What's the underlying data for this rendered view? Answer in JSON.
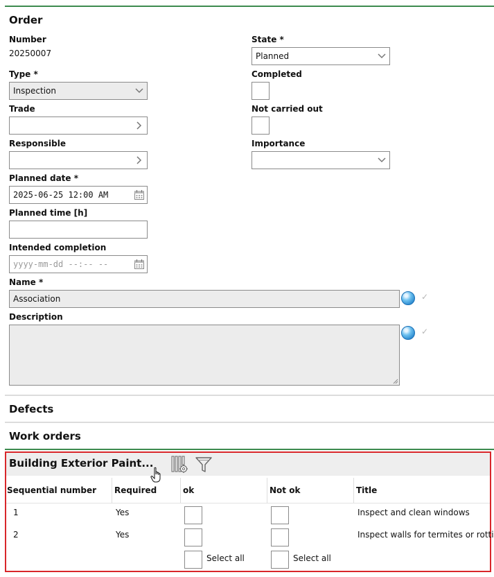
{
  "order": {
    "title": "Order",
    "number_label": "Number",
    "number_value": "20250007",
    "state_label": "State *",
    "state_value": "Planned",
    "type_label": "Type *",
    "type_value": "Inspection",
    "completed_label": "Completed",
    "trade_label": "Trade",
    "trade_value": "",
    "not_carried_out_label": "Not carried out",
    "responsible_label": "Responsible",
    "responsible_value": "",
    "importance_label": "Importance",
    "importance_value": "",
    "planned_date_label": "Planned date *",
    "planned_date_value": "2025-06-25 12:00 AM",
    "planned_time_label": "Planned time [h]",
    "planned_time_value": "",
    "intended_completion_label": "Intended completion",
    "intended_completion_placeholder": "yyyy-mm-dd --:-- --",
    "name_label": "Name *",
    "name_value": "Association",
    "description_label": "Description",
    "description_value": ""
  },
  "sections": {
    "defects": "Defects",
    "work_orders": "Work orders"
  },
  "checklist": {
    "title": "Building Exterior Paint...",
    "columns": {
      "sequential": "Sequential number",
      "required": "Required",
      "ok": "ok",
      "not_ok": "Not ok",
      "title": "Title"
    },
    "rows": [
      {
        "sequential": "1",
        "required": "Yes",
        "title": "Inspect and clean windows"
      },
      {
        "sequential": "2",
        "required": "Yes",
        "title": "Inspect walls for termites or rotting"
      }
    ],
    "select_all_ok": "Select all",
    "select_all_not_ok": "Select all"
  },
  "icons": {
    "dropdown": "chevron-down-icon",
    "lookup": "chevron-right-icon",
    "calendar": "calendar-icon",
    "translate": "globe-icon",
    "column_settings": "column-settings-icon",
    "filter": "filter-icon",
    "cursor": "hand-cursor-icon"
  },
  "colors": {
    "accent_line": "#3c8a4e",
    "highlight_border": "#d8262a",
    "disabled_bg": "#ececec"
  }
}
